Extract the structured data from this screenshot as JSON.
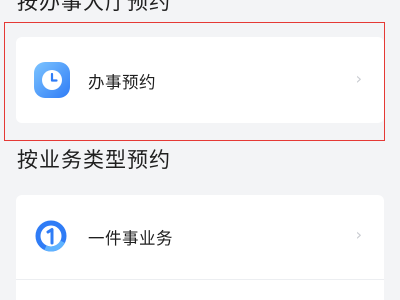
{
  "sections": [
    {
      "title": "按办事大厅预约",
      "items": [
        {
          "label": "办事预约",
          "icon": "clock-icon",
          "chevron": "›"
        }
      ]
    },
    {
      "title": "按业务类型预约",
      "items": [
        {
          "label": "一件事业务",
          "icon": "one-item-icon",
          "chevron": "›"
        }
      ]
    }
  ],
  "colors": {
    "highlight": "#e53935",
    "icon_blue": "#2f7cf6",
    "icon_light_blue": "#5fb3ff",
    "background": "#f3f4f6",
    "card": "#ffffff"
  }
}
